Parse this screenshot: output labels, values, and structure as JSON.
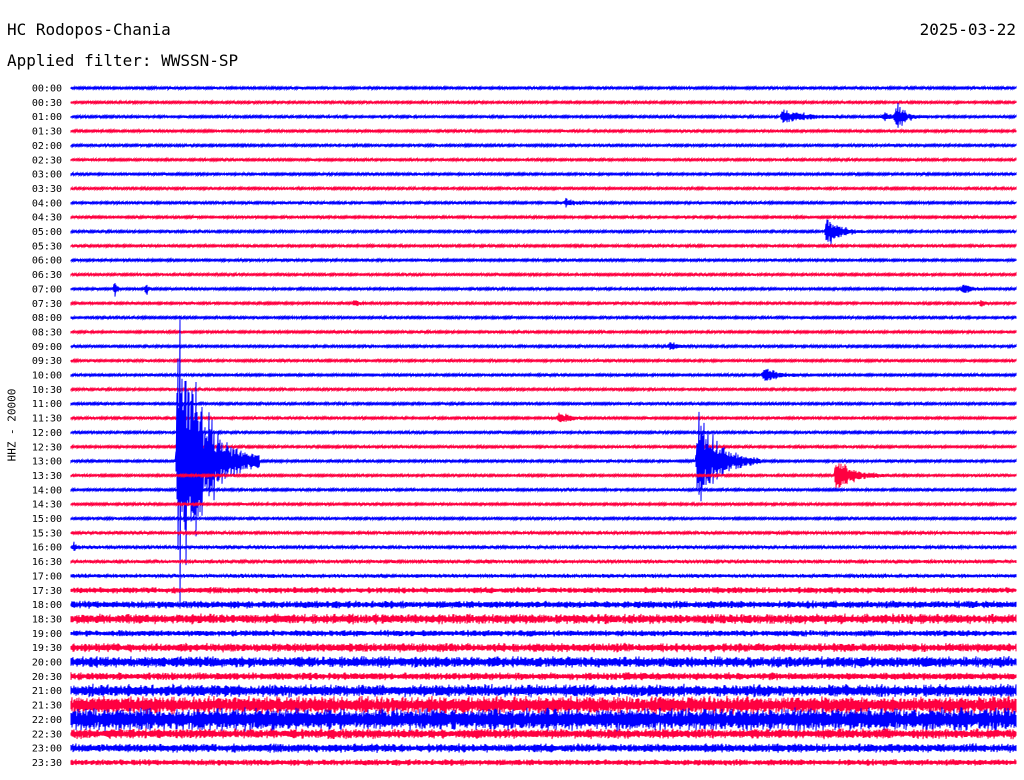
{
  "header": {
    "station": "HC Rodopos-Chania",
    "date": "2025-03-22",
    "filter": "Applied filter: WWSSN-SP"
  },
  "chart_data": {
    "type": "seismogram-helicorder",
    "ylabel": "HHZ - 20000",
    "traces": [
      "00:00",
      "00:30",
      "01:00",
      "01:30",
      "02:00",
      "02:30",
      "03:00",
      "03:30",
      "04:00",
      "04:30",
      "05:00",
      "05:30",
      "06:00",
      "06:30",
      "07:00",
      "07:30",
      "08:00",
      "08:30",
      "09:00",
      "09:30",
      "10:00",
      "10:30",
      "11:00",
      "11:30",
      "12:00",
      "12:30",
      "13:00",
      "13:30",
      "14:00",
      "14:30",
      "15:00",
      "15:30",
      "16:00",
      "16:30",
      "17:00",
      "17:30",
      "18:00",
      "18:30",
      "19:00",
      "19:30",
      "20:00",
      "20:30",
      "21:00",
      "21:30",
      "22:00",
      "22:30",
      "23:00",
      "23:30"
    ],
    "colors": {
      "even": "#0000ff",
      "odd": "#ff0040"
    },
    "trace_minutes": 30,
    "noise_amplitude": [
      1,
      1,
      1,
      1,
      1,
      1,
      1,
      1,
      1,
      1,
      1,
      1,
      1,
      1,
      1,
      1,
      1,
      1,
      1,
      1,
      1,
      1,
      1,
      1,
      1,
      1,
      1,
      1,
      1,
      1,
      1,
      1.2,
      1.2,
      1.3,
      1.5,
      2.5,
      3,
      4,
      2.5,
      3.5,
      4.5,
      3,
      5,
      7,
      9,
      4,
      3.5,
      2.5
    ],
    "events": [
      {
        "trace": "01:00",
        "minute": 22.6,
        "amplitude": 10,
        "duration_min": 1.8
      },
      {
        "trace": "01:00",
        "minute": 25.8,
        "amplitude": 5,
        "duration_min": 1
      },
      {
        "trace": "01:00",
        "minute": 26.2,
        "amplitude": 14,
        "duration_min": 1
      },
      {
        "trace": "04:00",
        "minute": 15.7,
        "amplitude": 5,
        "duration_min": 0.8
      },
      {
        "trace": "05:00",
        "minute": 24.0,
        "amplitude": 20,
        "duration_min": 1.2
      },
      {
        "trace": "07:00",
        "minute": 1.4,
        "amplitude": 10,
        "duration_min": 0.2
      },
      {
        "trace": "07:00",
        "minute": 2.4,
        "amplitude": 7,
        "duration_min": 0.2
      },
      {
        "trace": "07:00",
        "minute": 28.3,
        "amplitude": 7,
        "duration_min": 0.7
      },
      {
        "trace": "07:30",
        "minute": 9.0,
        "amplitude": 6,
        "duration_min": 0.3
      },
      {
        "trace": "07:30",
        "minute": 28.9,
        "amplitude": 5,
        "duration_min": 0.4
      },
      {
        "trace": "09:00",
        "minute": 19.0,
        "amplitude": 5,
        "duration_min": 0.9
      },
      {
        "trace": "10:00",
        "minute": 22.0,
        "amplitude": 12,
        "duration_min": 1.2
      },
      {
        "trace": "11:30",
        "minute": 15.5,
        "amplitude": 8,
        "duration_min": 0.9
      },
      {
        "trace": "13:00",
        "minute": 3.4,
        "amplitude": 170,
        "duration_min": 2.6
      },
      {
        "trace": "13:00",
        "minute": 19.9,
        "amplitude": 60,
        "duration_min": 2.0
      },
      {
        "trace": "13:30",
        "minute": 24.3,
        "amplitude": 25,
        "duration_min": 1.5
      },
      {
        "trace": "16:00",
        "minute": 0.1,
        "amplitude": 5,
        "duration_min": 0.3
      }
    ]
  }
}
